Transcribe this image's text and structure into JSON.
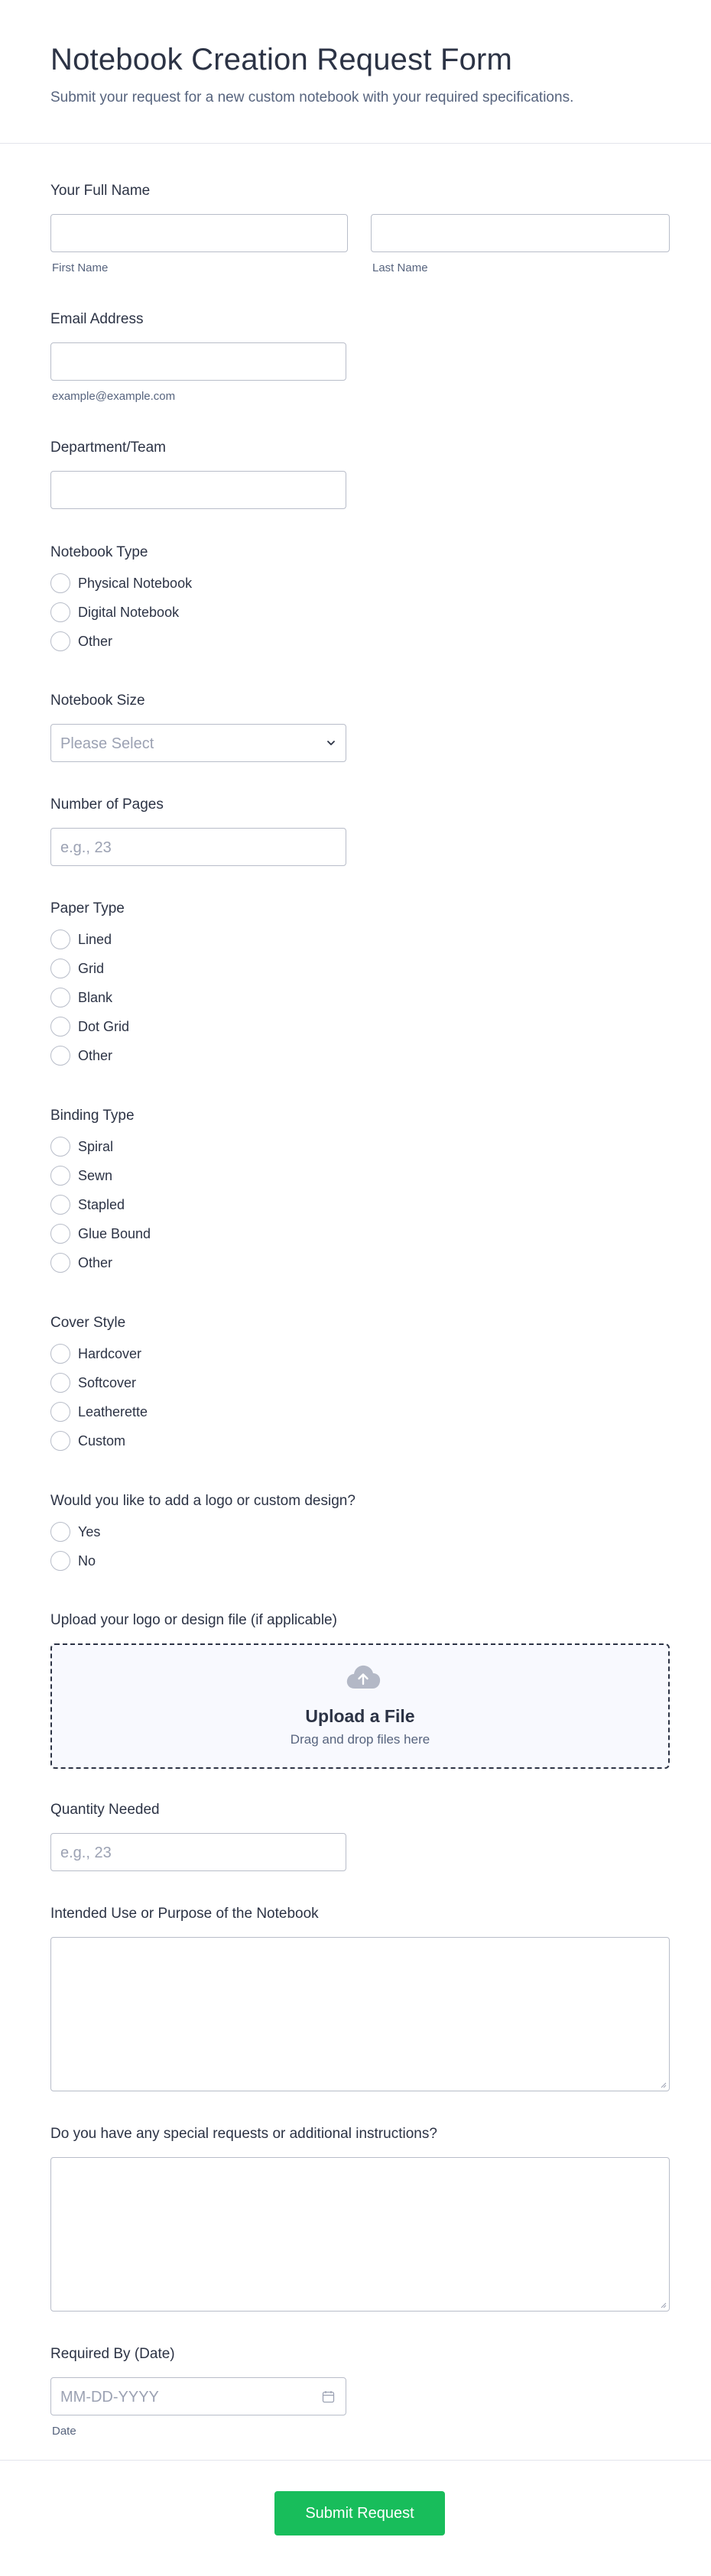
{
  "header": {
    "title": "Notebook Creation Request Form",
    "subtitle": "Submit your request for a new custom notebook with your required specifications."
  },
  "full_name": {
    "label": "Your Full Name",
    "first_sublabel": "First Name",
    "last_sublabel": "Last Name"
  },
  "email": {
    "label": "Email Address",
    "sublabel": "example@example.com"
  },
  "department": {
    "label": "Department/Team"
  },
  "notebook_type": {
    "label": "Notebook Type",
    "options": [
      "Physical Notebook",
      "Digital Notebook",
      "Other"
    ]
  },
  "notebook_size": {
    "label": "Notebook Size",
    "placeholder": "Please Select"
  },
  "pages": {
    "label": "Number of Pages",
    "placeholder": "e.g., 23"
  },
  "paper_type": {
    "label": "Paper Type",
    "options": [
      "Lined",
      "Grid",
      "Blank",
      "Dot Grid",
      "Other"
    ]
  },
  "binding_type": {
    "label": "Binding Type",
    "options": [
      "Spiral",
      "Sewn",
      "Stapled",
      "Glue Bound",
      "Other"
    ]
  },
  "cover_style": {
    "label": "Cover Style",
    "options": [
      "Hardcover",
      "Softcover",
      "Leatherette",
      "Custom"
    ]
  },
  "logo": {
    "label": "Would you like to add a logo or custom design?",
    "options": [
      "Yes",
      "No"
    ]
  },
  "upload": {
    "label": "Upload your logo or design file (if applicable)",
    "title": "Upload a File",
    "subtitle": "Drag and drop files here"
  },
  "quantity": {
    "label": "Quantity Needed",
    "placeholder": "e.g., 23"
  },
  "purpose": {
    "label": "Intended Use or Purpose of the Notebook"
  },
  "special": {
    "label": "Do you have any special requests or additional instructions?"
  },
  "required_by": {
    "label": "Required By (Date)",
    "placeholder": "MM-DD-YYYY",
    "sublabel": "Date"
  },
  "submit": {
    "label": "Submit Request",
    "color": "#18bd5b"
  },
  "icons": {
    "select": "chevron-down-icon",
    "upload": "cloud-upload-icon",
    "calendar": "calendar-icon"
  }
}
